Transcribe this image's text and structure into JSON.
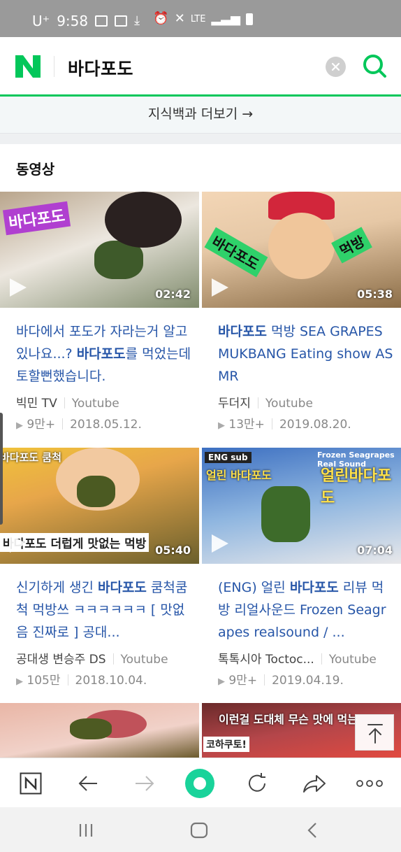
{
  "status_bar": {
    "carrier": "U⁺",
    "time": "9:58",
    "network": "LTE"
  },
  "search": {
    "query": "바다포도",
    "logo_letter": "N"
  },
  "knowledge_panel": {
    "more_link": "지식백과 더보기 →"
  },
  "videos": {
    "section_title": "동영상",
    "items": [
      {
        "duration": "02:42",
        "title_parts": [
          "바다에서 포도가 자라는거 알고있나요...? ",
          "바다포도",
          "를 먹었는데 토할뻔했습니다."
        ],
        "channel": "빅민 TV",
        "source": "Youtube",
        "views": "9만+",
        "date": "2018.05.12.",
        "thumb_text": "바다포도"
      },
      {
        "duration": "05:38",
        "title_parts": [
          "",
          "바다포도",
          " 먹방 SEA GRAPES MUKBANG Eating show ASMR"
        ],
        "channel": "두더지",
        "source": "Youtube",
        "views": "13만+",
        "date": "2019.08.20.",
        "thumb_text": "바다포도"
      },
      {
        "duration": "05:40",
        "title_parts": [
          "신기하게 생긴 ",
          "바다포도",
          " 쿰척쿰척 먹방쓰 ㅋㅋㅋㅋㅋㅋ [ 맛없음 진짜로 ] 공대..."
        ],
        "channel": "공대생 변승주 DS",
        "source": "Youtube",
        "views": "105만",
        "date": "2018.10.04.",
        "thumb_text": "바다포도 더럽게 맛없는 먹방"
      },
      {
        "duration": "07:04",
        "title_parts": [
          "(ENG) 얼린 ",
          "바다포도",
          " 리뷰 먹방 리얼사운드 Frozen Seagrapes realsound / ..."
        ],
        "channel": "톡톡시아 Toctoc...",
        "source": "Youtube",
        "views": "9만+",
        "date": "2019.04.19.",
        "thumb_text": "얼린 바다포도"
      },
      {
        "thumb_text": ""
      },
      {
        "thumb_text": "이런걸 도대체 무슨 맛에 먹는"
      }
    ]
  },
  "colors": {
    "naver_green": "#03c75a",
    "link_blue": "#2756a8"
  }
}
